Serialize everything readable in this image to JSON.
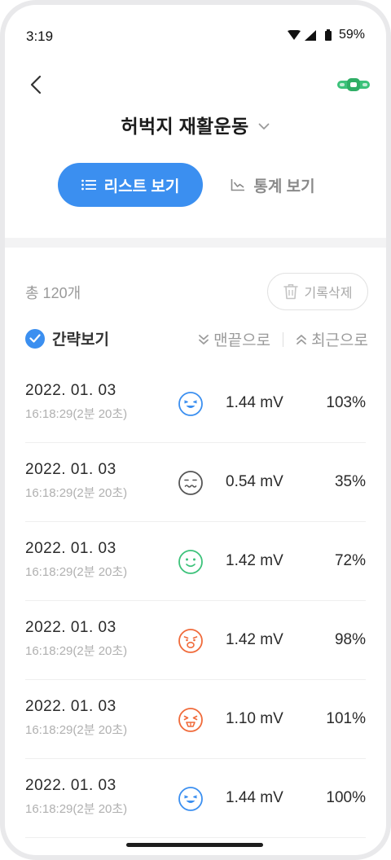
{
  "status_bar": {
    "time": "3:19",
    "battery": "59%"
  },
  "header": {
    "title": "허벅지 재활운동"
  },
  "tabs": {
    "list_label": "리스트 보기",
    "stats_label": "통계 보기"
  },
  "summary": {
    "total_count": "총 120개",
    "delete_label": "기록삭제"
  },
  "options": {
    "compact_label": "간략보기",
    "to_end_label": "맨끝으로",
    "to_recent_label": "최근으로"
  },
  "records": [
    {
      "date": "2022. 01. 03",
      "duration": "16:18:29(2분 20초)",
      "face": "happy-blue-face-icon",
      "mv": "1.44 mV",
      "pct": "103%"
    },
    {
      "date": "2022. 01. 03",
      "duration": "16:18:29(2분 20초)",
      "face": "tired-gray-face-icon",
      "mv": "0.54 mV",
      "pct": "35%"
    },
    {
      "date": "2022. 01. 03",
      "duration": "16:18:29(2분 20초)",
      "face": "smile-green-face-icon",
      "mv": "1.42 mV",
      "pct": "72%"
    },
    {
      "date": "2022. 01. 03",
      "duration": "16:18:29(2분 20초)",
      "face": "surprised-orange-face-icon",
      "mv": "1.42 mV",
      "pct": "98%"
    },
    {
      "date": "2022. 01. 03",
      "duration": "16:18:29(2분 20초)",
      "face": "strained-orange-face-icon",
      "mv": "1.10 mV",
      "pct": "101%"
    },
    {
      "date": "2022. 01. 03",
      "duration": "16:18:29(2분 20초)",
      "face": "happy-blue-face-icon",
      "mv": "1.44 mV",
      "pct": "100%"
    }
  ],
  "colors": {
    "accent": "#3b8ff0",
    "face_blue": "#3b8ff0",
    "face_gray": "#555555",
    "face_green": "#3cc27a",
    "face_orange": "#f06a3a"
  }
}
